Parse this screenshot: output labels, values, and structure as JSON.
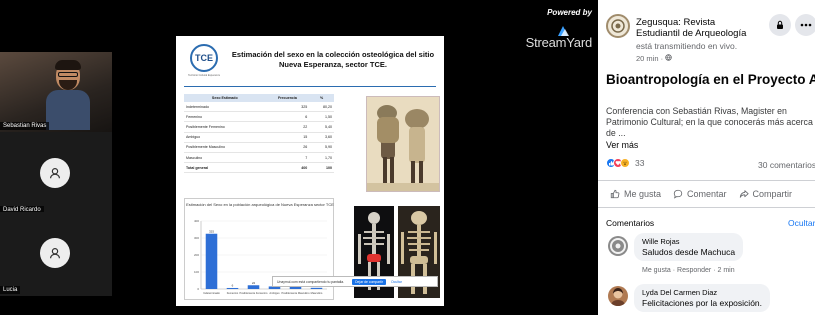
{
  "stream": {
    "powered_by": "Powered by",
    "brand_name": "StreamYard",
    "participants": [
      {
        "name": "Sebastian Rivas"
      },
      {
        "name": "David Ricardo"
      },
      {
        "name": "Lucia"
      }
    ]
  },
  "slide": {
    "logo_text": "TCE",
    "logo_subtitle": "Territorio Cultural Esperanza",
    "title": "Estimación del sexo en la colección osteológica del sitio Nueva Esperanza, sector TCE.",
    "table": {
      "headers": [
        "Sexo Estimado",
        "Frecuencia",
        "%"
      ],
      "rows": [
        [
          "Indeterminado",
          "325",
          "80,20"
        ],
        [
          "Femenino",
          "6",
          "1,50"
        ],
        [
          "Posiblemente Femenino",
          "22",
          "5,40"
        ],
        [
          "Ambiguo",
          "15",
          "3,60"
        ],
        [
          "Posiblemente Masculino",
          "26",
          "5,90"
        ],
        [
          "Masculino",
          "7",
          "1,70"
        ]
      ],
      "total": [
        "Total general",
        "400",
        "100"
      ]
    },
    "chart_title": "Estimación del Sexo en la población arqueológica de Nueva Esperanza sector TCE",
    "share_text": "Unaymul.com está compartiendo tu pantalla.",
    "share_stop": "Dejar de compartir",
    "share_hide": "Ocultar"
  },
  "chart_data": {
    "type": "bar",
    "title": "Estimación del Sexo en la población arqueológica de Nueva Esperanza sector TCE",
    "categories": [
      "Indeterminado",
      "Femenino",
      "Posiblemente Femenino",
      "Ambiguo",
      "Posiblemente Masculino",
      "Masculino"
    ],
    "values": [
      325,
      6,
      22,
      15,
      26,
      7
    ],
    "ylim": [
      0,
      400
    ],
    "colors": {
      "bar": "#2e6fd6"
    }
  },
  "panel": {
    "page_name": "Zegusqua: Revista Estudiantil de Arqueología",
    "status": "está transmitiendo en vivo.",
    "time": "20 min ·",
    "post_title": "Bioantropología en el Proyecto Arqueológico Nueva Esperanza",
    "description": "Conferencia con Sebastián Rivas, Magister en Patrimonio Cultural; en la que conocerás más acerca de ...",
    "see_more": "Ver más",
    "reaction_count": "33",
    "comment_count": "30 comentarios",
    "actions": {
      "like": "Me gusta",
      "comment": "Comentar",
      "share": "Compartir"
    },
    "comments_heading": "Comentarios",
    "hide_label": "Ocultar",
    "comments": [
      {
        "author": "Wille Rojas",
        "text": "Saludos desde Machuca",
        "meta": "Me gusta · Responder · 2 min"
      },
      {
        "author": "Lyda Del Carmen Diaz",
        "text": "Felicitaciones por la exposición."
      }
    ]
  },
  "colors": {
    "fb_blue": "#1877f2",
    "panel_bg": "#ffffff",
    "stage_bg": "#000000"
  }
}
